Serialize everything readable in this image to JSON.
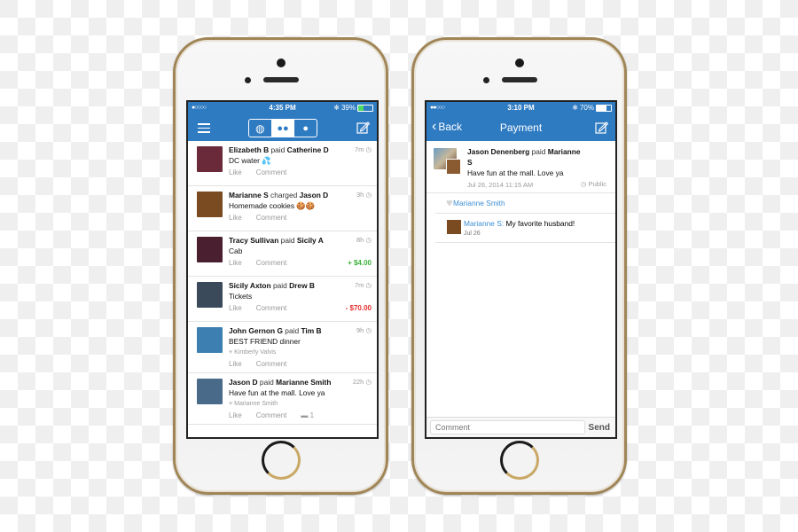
{
  "phone1": {
    "status": {
      "signal": "●○○○○",
      "time": "4:35 PM",
      "bluetooth": "✱",
      "battery": "39%",
      "battery_level": 0.39,
      "battery_color": "#4cd964"
    },
    "nav": {
      "menu_icon": "hamburger-icon",
      "segments": [
        {
          "icon": "globe-icon",
          "glyph": "◍",
          "active": false
        },
        {
          "icon": "friends-icon",
          "glyph": "👥",
          "active": true
        },
        {
          "icon": "person-icon",
          "glyph": "👤",
          "active": false
        }
      ],
      "compose_icon": "compose-icon"
    },
    "feed": [
      {
        "actor": "Elizabeth B",
        "verb": "paid",
        "target": "Catherine D",
        "message": "DC water 💦",
        "age": "7m",
        "likes": "",
        "like_label": "Like",
        "comment_label": "Comment",
        "amount": "",
        "comment_count": "",
        "avatar_color": "#6b2a3a"
      },
      {
        "actor": "Marianne S",
        "verb": "charged",
        "target": "Jason D",
        "message": "Homemade cookies 🍪🍪",
        "age": "3h",
        "likes": "",
        "like_label": "Like",
        "comment_label": "Comment",
        "amount": "",
        "comment_count": "",
        "avatar_color": "#7a4a20"
      },
      {
        "actor": "Tracy Sullivan",
        "verb": "paid",
        "target": "Sicily A",
        "message": "Cab",
        "age": "8h",
        "likes": "",
        "like_label": "Like",
        "comment_label": "Comment",
        "amount": "+ $4.00",
        "amount_color": "#3bb33b",
        "comment_count": "",
        "avatar_color": "#4a2030"
      },
      {
        "actor": "Sicily Axton",
        "verb": "paid",
        "target": "Drew B",
        "message": "Tickets",
        "age": "7m",
        "likes": "",
        "like_label": "Like",
        "comment_label": "Comment",
        "amount": "- $70.00",
        "amount_color": "#e8302e",
        "comment_count": "",
        "avatar_color": "#3a4a5a"
      },
      {
        "actor": "John Gernon G",
        "verb": "paid",
        "target": "Tim B",
        "message": "BEST FRIEND dinner",
        "age": "9h",
        "likes": "Kimberly Valvis",
        "like_label": "Like",
        "comment_label": "Comment",
        "amount": "",
        "comment_count": "",
        "avatar_color": "#3d7fb0"
      },
      {
        "actor": "Jason D",
        "verb": "paid",
        "target": "Marianne Smith",
        "message": "Have fun at the mall. Love ya",
        "age": "22h",
        "likes": "Marianne Smith",
        "like_label": "Like",
        "comment_label": "Comment",
        "amount": "",
        "comment_count": "1",
        "avatar_color": "#4a6a8a"
      }
    ]
  },
  "phone2": {
    "status": {
      "signal": "●●○○○",
      "time": "3:10 PM",
      "bluetooth": "✱",
      "battery": "70%",
      "battery_level": 0.7,
      "battery_color": "#ffffff"
    },
    "nav": {
      "back_label": "Back",
      "title": "Payment",
      "compose_icon": "compose-icon"
    },
    "payment": {
      "actor": "Jason Denenberg",
      "verb": "paid",
      "target": "Marianne S",
      "message": "Have fun at the mall. Love ya",
      "date": "Jul 26, 2014 11:15 AM",
      "privacy": "Public"
    },
    "liked_by": "Marianne Smith",
    "comments": [
      {
        "author": "Marianne S:",
        "text": "My favorite husband!",
        "date": "Jul 26"
      }
    ],
    "composer": {
      "placeholder": "Comment",
      "send_label": "Send"
    }
  },
  "colors": {
    "brand": "#2f7bc2",
    "link": "#3d8fd4",
    "positive": "#3bb33b",
    "negative": "#e8302e"
  }
}
